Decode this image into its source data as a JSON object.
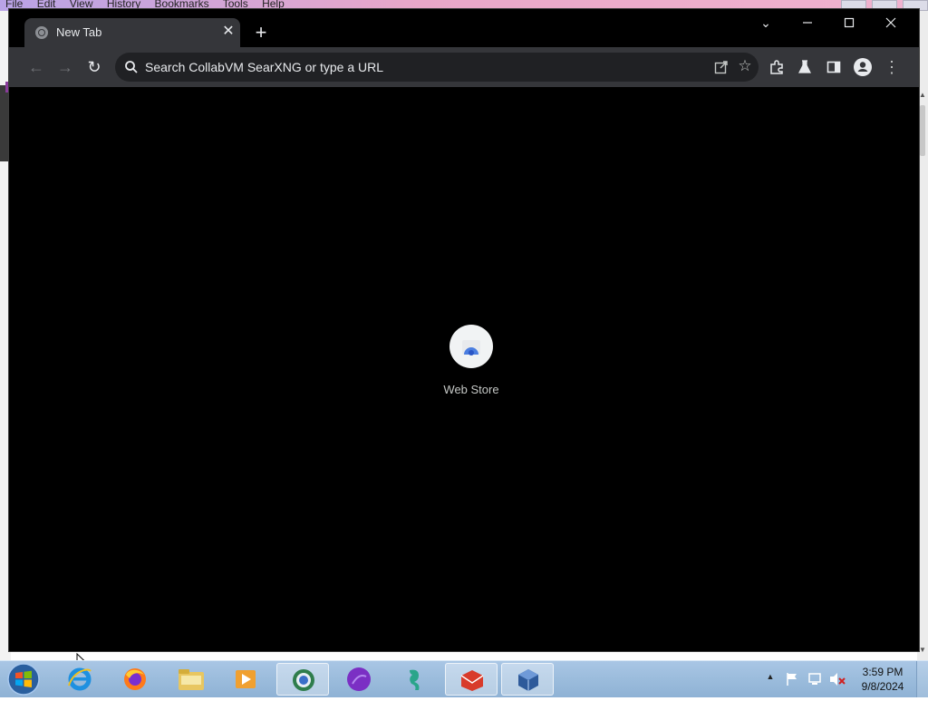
{
  "background_app": {
    "menus": [
      "File",
      "Edit",
      "View",
      "History",
      "Bookmarks",
      "Tools",
      "Help"
    ]
  },
  "browser": {
    "tab": {
      "title": "New Tab",
      "close_label": "✕"
    },
    "new_tab_label": "+",
    "window_controls": {
      "tab_search": "⌄",
      "minimize": "—",
      "maximize": "☐",
      "close": "✕"
    },
    "toolbar": {
      "back": "←",
      "forward": "→",
      "reload": "↻",
      "omnibox_placeholder": "Search CollabVM SearXNG or type a URL",
      "bookmark_star": "☆",
      "menu": "⋮"
    },
    "shortcuts": [
      {
        "label": "Web Store",
        "icon": "chrome-web-store-icon"
      }
    ]
  },
  "taskbar": {
    "pinned_apps": [
      {
        "name": "internet-explorer",
        "icon": "internet-explorer-icon",
        "active": false
      },
      {
        "name": "firefox",
        "icon": "firefox-icon",
        "active": false
      },
      {
        "name": "file-explorer",
        "icon": "folder-icon",
        "active": false
      },
      {
        "name": "media-player",
        "icon": "media-player-icon",
        "active": false
      },
      {
        "name": "chrome",
        "icon": "chrome-icon",
        "active": true
      },
      {
        "name": "purple-app",
        "icon": "purple-orb-icon",
        "active": false
      },
      {
        "name": "seahorse-app",
        "icon": "seahorse-icon",
        "active": false
      },
      {
        "name": "red-app",
        "icon": "red-app-icon",
        "active": true
      },
      {
        "name": "virtualbox",
        "icon": "virtualbox-icon",
        "active": true
      }
    ],
    "tray_expand": "▲",
    "clock": {
      "time": "3:59 PM",
      "date": "9/8/2024"
    }
  },
  "colors": {
    "chrome_frame": "#000000",
    "chrome_toolbar": "#35363a",
    "omnibox": "#202124",
    "text": "#e8eaed",
    "taskbar": "#9bbcdc"
  }
}
